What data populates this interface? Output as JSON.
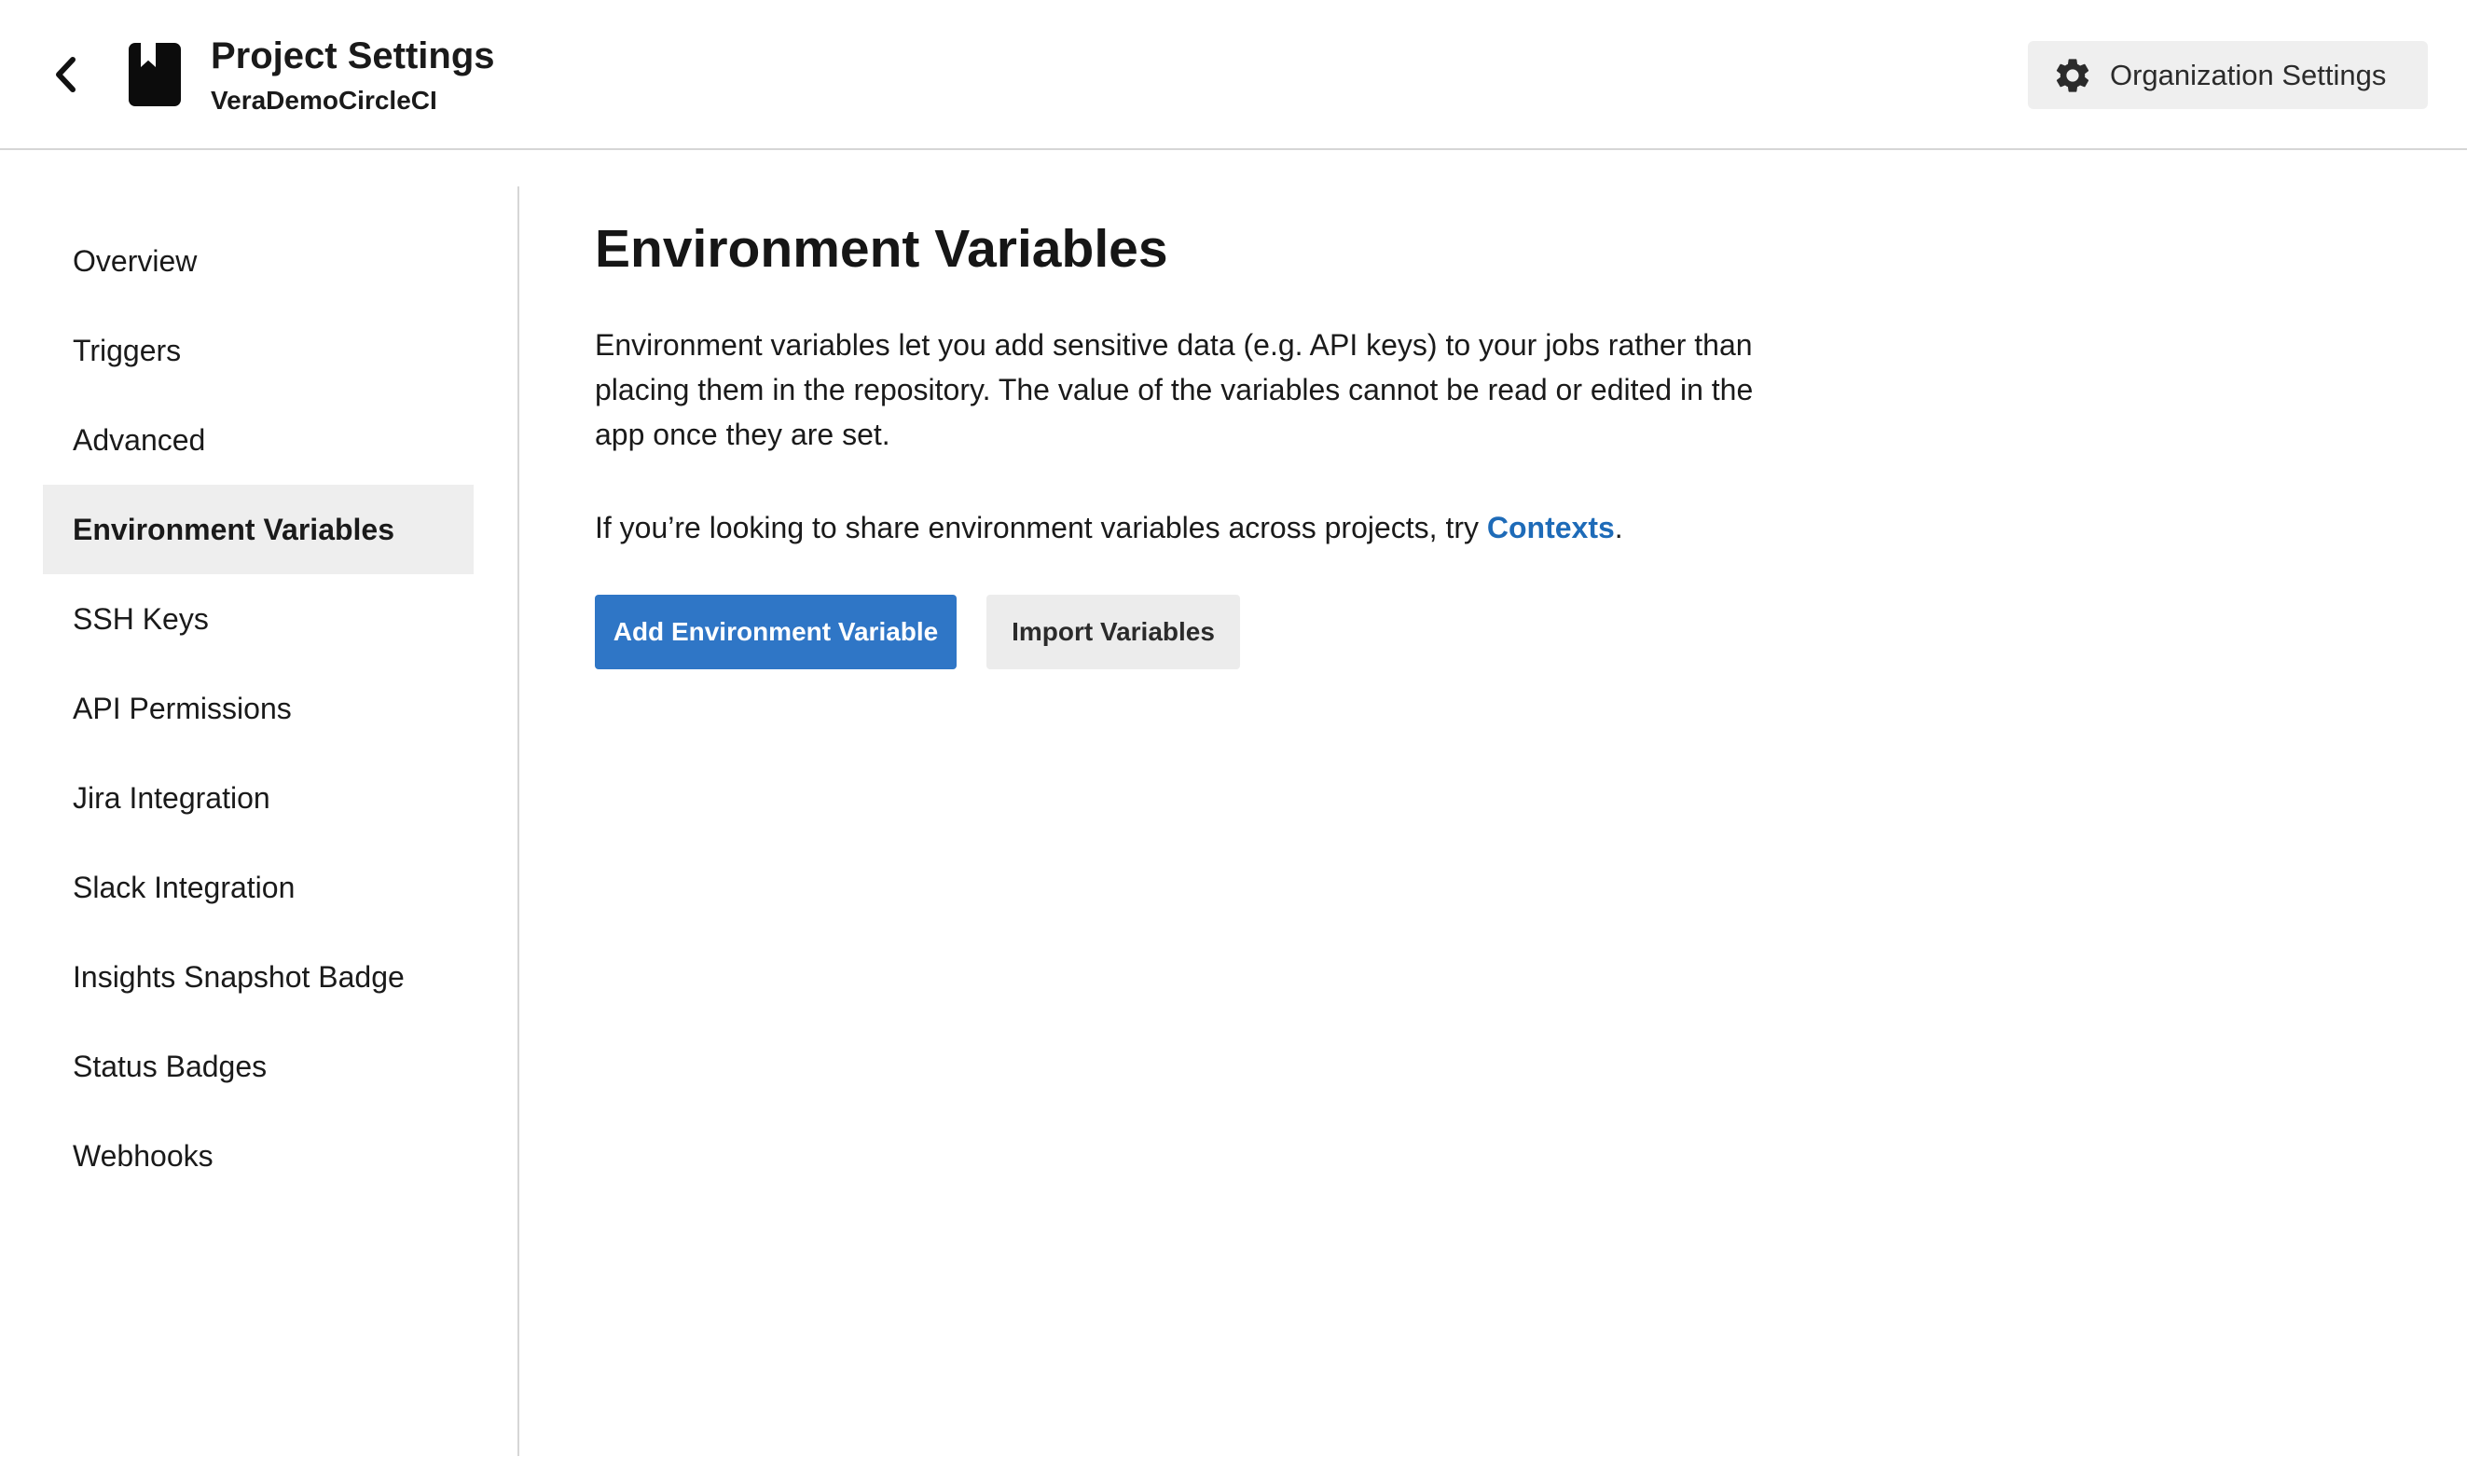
{
  "header": {
    "back_icon": "chevron-left-icon",
    "project_icon": "bookmark-icon",
    "title": "Project Settings",
    "subtitle": "VeraDemoCircleCI",
    "org_settings": {
      "icon": "gear-icon",
      "label": "Organization Settings"
    }
  },
  "sidebar": {
    "items": [
      {
        "label": "Overview",
        "active": false
      },
      {
        "label": "Triggers",
        "active": false
      },
      {
        "label": "Advanced",
        "active": false
      },
      {
        "label": "Environment Variables",
        "active": true
      },
      {
        "label": "SSH Keys",
        "active": false
      },
      {
        "label": "API Permissions",
        "active": false
      },
      {
        "label": "Jira Integration",
        "active": false
      },
      {
        "label": "Slack Integration",
        "active": false
      },
      {
        "label": "Insights Snapshot Badge",
        "active": false
      },
      {
        "label": "Status Badges",
        "active": false
      },
      {
        "label": "Webhooks",
        "active": false
      }
    ]
  },
  "main": {
    "title": "Environment Variables",
    "description": "Environment variables let you add sensitive data (e.g. API keys) to your jobs rather than placing them in the repository. The value of the variables cannot be read or edited in the app once they are set.",
    "contexts_prefix": "If you’re looking to share environment variables across projects, try ",
    "contexts_link": "Contexts",
    "contexts_suffix": ".",
    "add_button": "Add Environment Variable",
    "import_button": "Import Variables"
  },
  "colors": {
    "primary": "#2f76c6",
    "link": "#1e6bb8",
    "active_bg": "#eeeeee",
    "secondary_bg": "#ececec"
  }
}
